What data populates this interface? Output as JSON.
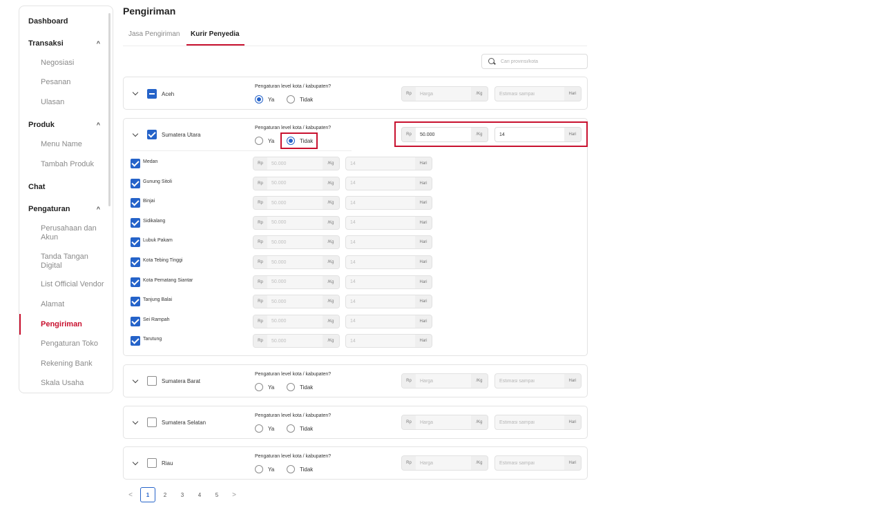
{
  "sidebar": {
    "sections": [
      {
        "label": "Dashboard"
      },
      {
        "label": "Transaksi",
        "children": [
          "Negosiasi",
          "Pesanan",
          "Ulasan"
        ]
      },
      {
        "label": "Produk",
        "children": [
          "Menu Name",
          "Tambah Produk"
        ]
      },
      {
        "label": "Chat"
      },
      {
        "label": "Pengaturan",
        "children": [
          "Perusahaan dan Akun",
          "Tanda Tangan Digital",
          "List Official Vendor",
          "Alamat",
          "Pengiriman",
          "Pengaturan Toko",
          "Rekening Bank",
          "Skala Usaha"
        ]
      }
    ],
    "active": "Pengiriman",
    "caret": "^"
  },
  "page": {
    "title": "Pengiriman"
  },
  "tabs": [
    {
      "label": "Jasa Pengiriman"
    },
    {
      "label": "Kurir Penyedia",
      "active": true
    }
  ],
  "search": {
    "placeholder": "Cari provinsi/kota",
    "icon": "search-icon"
  },
  "common": {
    "question": "Pengaturan level kota / kabupaten?",
    "yes": "Ya",
    "no": "Tidak",
    "rp": "Rp",
    "per_kg": "/Kg",
    "hari": "Hari",
    "price_placeholder": "Harga",
    "eta_placeholder": "Estimasi sampai"
  },
  "provinces": [
    {
      "name": "Aceh",
      "checked": "indeterminate",
      "selected": "Ya"
    },
    {
      "name": "Sumatera Utara",
      "checked": "checked",
      "selected": "Tidak",
      "price": "50.000",
      "eta": "14"
    },
    {
      "name": "Sumatera Barat",
      "checked": "unchecked",
      "selected": ""
    },
    {
      "name": "Sumatera Selatan",
      "checked": "unchecked",
      "selected": ""
    },
    {
      "name": "Riau",
      "checked": "unchecked",
      "selected": ""
    }
  ],
  "cities": [
    {
      "name": "Medan",
      "price": "50.000",
      "eta": "14"
    },
    {
      "name": "Gunung Sitoli",
      "price": "50.000",
      "eta": "14"
    },
    {
      "name": "Binjai",
      "price": "50.000",
      "eta": "14"
    },
    {
      "name": "Sidikalang",
      "price": "50.000",
      "eta": "14"
    },
    {
      "name": "Lubuk Pakam",
      "price": "50.000",
      "eta": "14"
    },
    {
      "name": "Kota Tebing Tinggi",
      "price": "50.000",
      "eta": "14"
    },
    {
      "name": "Kota Pematang Siantar",
      "price": "50.000",
      "eta": "14"
    },
    {
      "name": "Tanjung Balai",
      "price": "50.000",
      "eta": "14"
    },
    {
      "name": "Sei Rampah",
      "price": "50.000",
      "eta": "14"
    },
    {
      "name": "Tarutung",
      "price": "50.000",
      "eta": "14"
    }
  ],
  "pagination": {
    "prev": "<",
    "next": ">",
    "pages": [
      "1",
      "2",
      "3",
      "4",
      "5"
    ],
    "current": "1"
  },
  "colors": {
    "accent": "#c8102e",
    "primary": "#2563c9"
  }
}
